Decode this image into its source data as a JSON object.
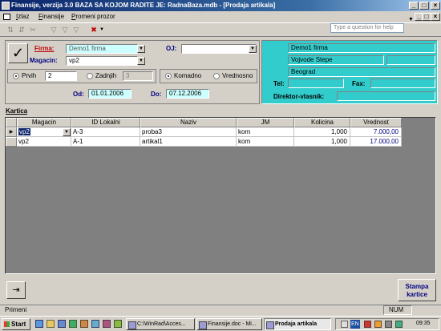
{
  "window": {
    "title": "Finansije, verzija 3.0        BAZA SA KOJOM RADITE JE: RadnaBaza.mdb - [Prodaja artikala]"
  },
  "menu": {
    "items": [
      "Izlaz",
      "Finansije",
      "Promeni prozor"
    ],
    "question_placeholder": "Type a question for help"
  },
  "filters": {
    "firma_label": "Firma:",
    "firma_value": "Demo1 firma",
    "oj_label": "OJ:",
    "oj_value": "",
    "magacin_label": "Magacin:",
    "magacin_value": "vp2",
    "prvih_label": "Prvih",
    "prvih_value": "2",
    "zadnjih_label": "Zadnjih",
    "zadnjih_value": "3",
    "komadno_label": "Komadno",
    "vrednosno_label": "Vrednosno",
    "od_label": "Od:",
    "od_value": "01.01.2006",
    "do_label": "Do:",
    "do_value": "07.12.2006"
  },
  "company": {
    "line1": "Demo1 firma",
    "line2": "Vojvode Stepe",
    "line3": "Beograd",
    "tel_label": "Tel:",
    "fax_label": "Fax:",
    "director_label": "Direktor-vlasnik:"
  },
  "kartica": {
    "label": "Kartica",
    "columns": [
      "Magacin",
      "ID Lokalni",
      "Naziv",
      "JM",
      "Kolicina",
      "Vrednost"
    ],
    "rows": [
      {
        "magacin": "vp2",
        "id": "A-3",
        "naziv": "proba3",
        "jm": "kom",
        "kolicina": "1,000",
        "vrednost": "7.000,00"
      },
      {
        "magacin": "vp2",
        "id": "A-1",
        "naziv": "artikal1",
        "jm": "kom",
        "kolicina": "1,000",
        "vrednost": "17.000,00"
      }
    ]
  },
  "footer": {
    "print_button": "Stampa kartice"
  },
  "status": {
    "left": "Primeni",
    "num": "NUM"
  },
  "taskbar": {
    "start": "Start",
    "tasks": [
      "C:\\WinRad\\Acces...",
      "Finansije.doc - Mi...",
      "Prodaja artikala"
    ],
    "lang": "EN",
    "time": "09:35"
  },
  "colors": {
    "title_start": "#0a246a",
    "teal": "#33cccc",
    "cyan_field": "#ccffff",
    "label_red": "#c00000",
    "label_navy": "#000080",
    "grid_bg": "#808080"
  }
}
